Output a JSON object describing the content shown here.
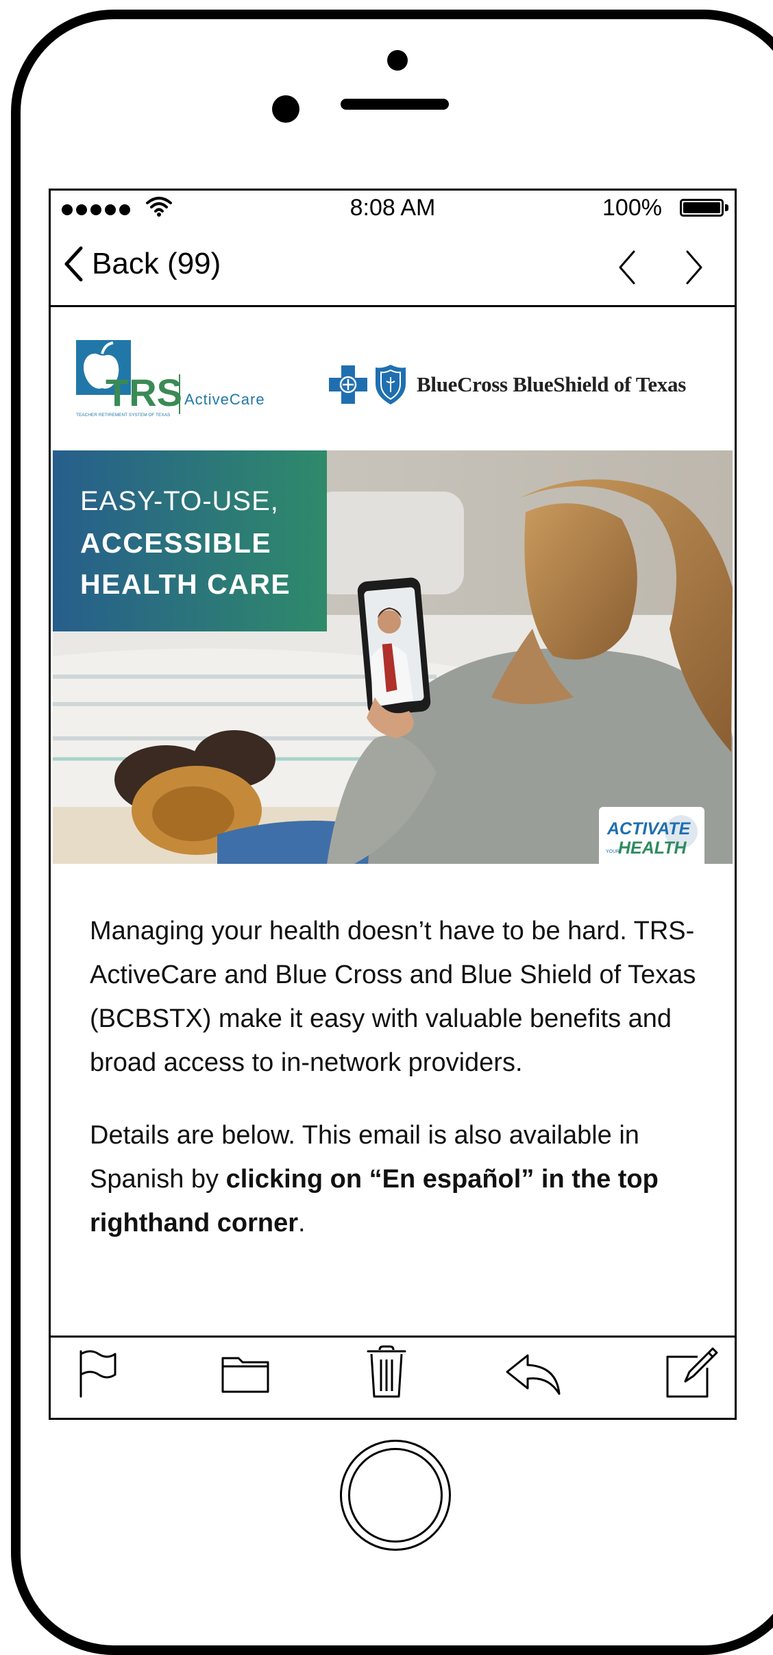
{
  "status_bar": {
    "time": "8:08 AM",
    "battery": "100%"
  },
  "nav": {
    "back_label": "Back (99)"
  },
  "logos": {
    "trs_main": "TRS",
    "trs_sub": "ActiveCare",
    "trs_caption": "TEACHER RETIREMENT SYSTEM OF TEXAS",
    "bcbs_name": "BlueCross BlueShield of Texas"
  },
  "hero": {
    "line1": "EASY-TO-USE,",
    "line2": "ACCESSIBLE",
    "line3": "HEALTH CARE",
    "badge_line1": "ACTIVATE",
    "badge_line2_small": "YOUR",
    "badge_line2": "HEALTH"
  },
  "email": {
    "paragraph1": "Managing your health doesn’t have to be hard. TRS-ActiveCare and Blue Cross and Blue Shield of Texas (BCBSTX) make it easy with valuable benefits and broad access to in-network providers.",
    "paragraph2_start": "Details are below. This email is also available in Spanish by ",
    "paragraph2_bold": "clicking on “En español” in the top righthand corner",
    "paragraph2_end": "."
  },
  "colors": {
    "banner_start": "#275e8c",
    "banner_end": "#2f8a6a",
    "trs_blue": "#2178a8",
    "trs_green": "#3a8a56",
    "bcbs_blue": "#1f6fb0"
  },
  "icons": [
    "flag-icon",
    "folder-icon",
    "trash-icon",
    "reply-icon",
    "compose-icon"
  ]
}
